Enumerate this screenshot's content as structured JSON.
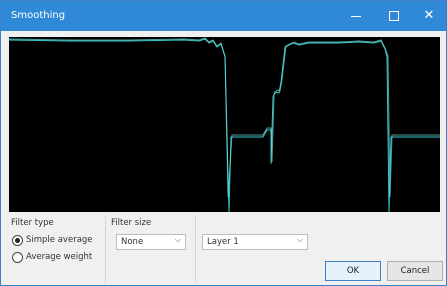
{
  "window": {
    "title": "Smoothing",
    "controls": {
      "minimize": "minimize-icon",
      "maximize": "maximize-icon",
      "close": "close-icon",
      "close_glyph": "✕"
    }
  },
  "filter_type": {
    "label": "Filter type",
    "options": [
      {
        "label": "Simple average",
        "selected": true
      },
      {
        "label": "Average weight",
        "selected": false
      }
    ]
  },
  "filter_size": {
    "label": "Filter size",
    "value": "None",
    "chevron": "⌵"
  },
  "layer": {
    "value": "Layer 1",
    "chevron": "⌵"
  },
  "buttons": {
    "ok": "OK",
    "cancel": "Cancel"
  },
  "plot": {
    "background": "#000000",
    "line_color": "#39c9c9"
  }
}
